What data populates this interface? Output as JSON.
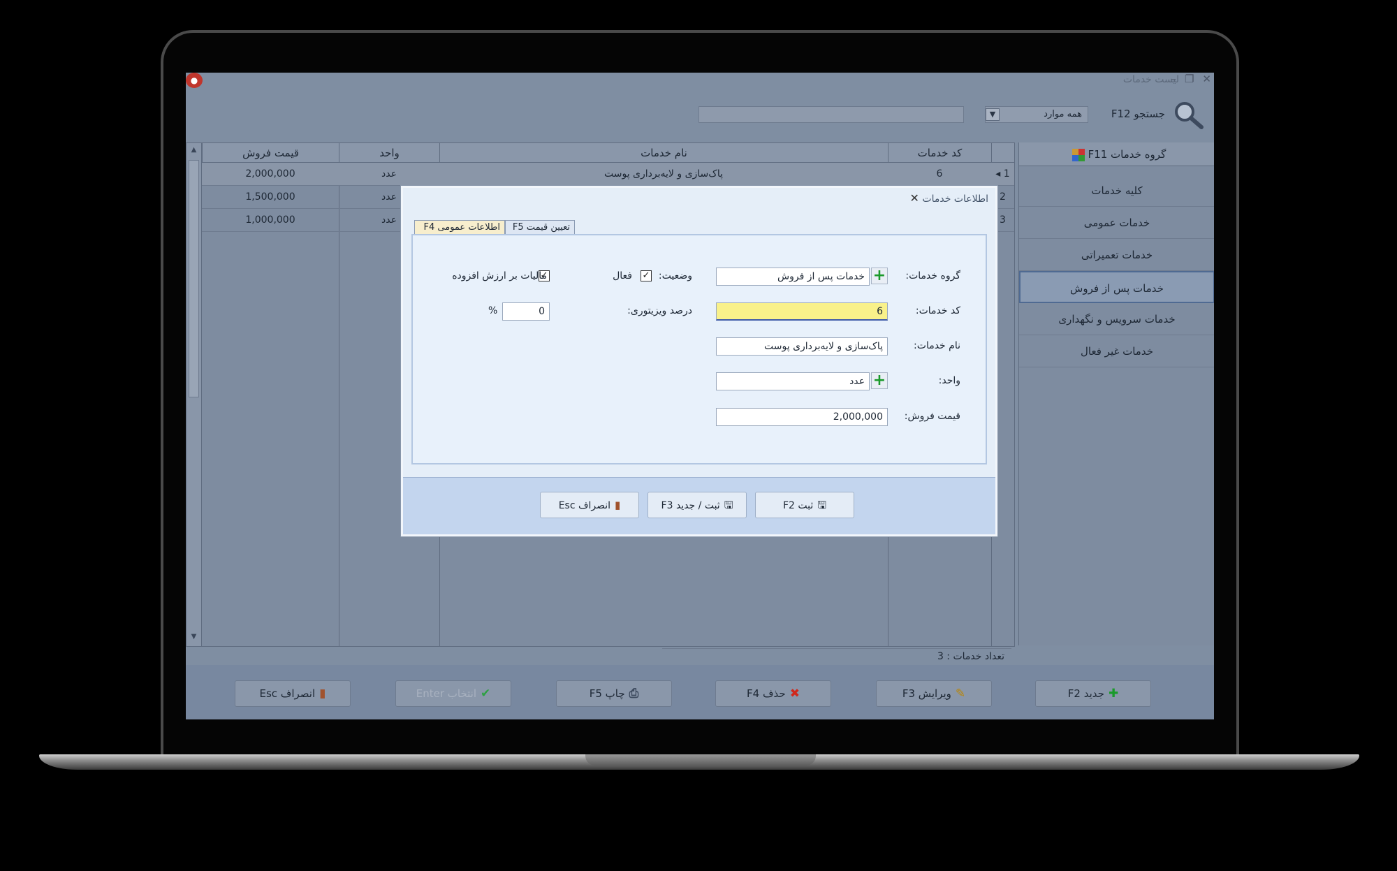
{
  "window": {
    "title": "لیست خدمات"
  },
  "search": {
    "label": "جستجو F12",
    "scope": "همه موارد",
    "value": ""
  },
  "grid": {
    "columns": {
      "price": "قیمت فروش",
      "unit": "واحد",
      "name": "نام خدمات",
      "code": "کد خدمات"
    },
    "rows": [
      {
        "index": "1",
        "code": "6",
        "name": "پاک‌سازی و لایه‌برداری پوست",
        "unit": "عدد",
        "price": "2,000,000"
      },
      {
        "index": "2",
        "code": "",
        "name": "",
        "unit": "عدد",
        "price": "1,500,000"
      },
      {
        "index": "3",
        "code": "",
        "name": "",
        "unit": "عدد",
        "price": "1,000,000"
      }
    ],
    "footer": "تعداد خدمات : 3"
  },
  "groups": {
    "header": "گروه خدمات F11",
    "items": [
      "کلیه خدمات",
      "خدمات عمومی",
      "خدمات تعمیراتی",
      "خدمات پس از فروش",
      "خدمات سرویس و نگهداری",
      "خدمات غیر فعال"
    ],
    "active_index": 3
  },
  "toolbar": {
    "new": "جدید F2",
    "edit": "ویرایش F3",
    "delete": "حذف F4",
    "print": "چاپ F5",
    "select": "انتخاب Enter",
    "cancel": "انصراف Esc"
  },
  "dialog": {
    "title": "اطلاعات خدمات",
    "tabs": {
      "general": "اطلاعات عمومی F4",
      "pricing": "تعیین قیمت F5"
    },
    "labels": {
      "group": "گروه خدمات:",
      "code": "کد خدمات:",
      "name": "نام خدمات:",
      "unit": "واحد:",
      "price": "قیمت فروش:",
      "status": "وضعیت:",
      "active": "فعال",
      "visitor": "درصد ویزیتوری:",
      "vat": "مالیات بر ارزش افزوده",
      "percent": "%"
    },
    "values": {
      "group": "خدمات پس از فروش",
      "code": "6",
      "name": "پاک‌سازی و لایه‌برداری پوست",
      "unit": "عدد",
      "price": "2,000,000",
      "visitor": "0",
      "active": true,
      "vat": true
    },
    "buttons": {
      "save": "ثبت F2",
      "save_new": "ثبت / جدید F3",
      "cancel": "انصراف Esc"
    }
  },
  "colors": {
    "screen_bg": "#7f8ea2",
    "dialog_bg": "#e5eef8",
    "focus_field": "#f9f18a",
    "add_green": "#1a9a2a",
    "delete_red": "#d0281c"
  }
}
